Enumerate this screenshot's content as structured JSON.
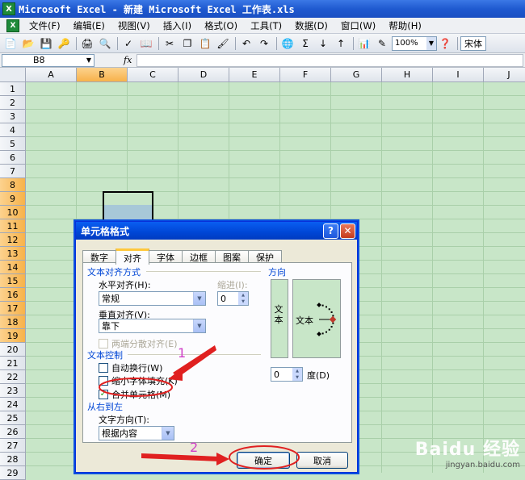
{
  "window": {
    "title": "Microsoft Excel - 新建 Microsoft Excel 工作表.xls",
    "app_icon": "excel-icon"
  },
  "menubar": [
    "文件(F)",
    "编辑(E)",
    "视图(V)",
    "插入(I)",
    "格式(O)",
    "工具(T)",
    "数据(D)",
    "窗口(W)",
    "帮助(H)"
  ],
  "toolbar": {
    "zoom": "100%",
    "font": "宋体"
  },
  "formula_bar": {
    "cell_ref": "B8",
    "fx": "fx",
    "value": ""
  },
  "columns": [
    "A",
    "B",
    "C",
    "D",
    "E",
    "F",
    "G",
    "H",
    "I",
    "J"
  ],
  "selected_column": "B",
  "rows": [
    "1",
    "2",
    "3",
    "4",
    "5",
    "6",
    "7",
    "8",
    "9",
    "10",
    "11",
    "12",
    "13",
    "14",
    "15",
    "16",
    "17",
    "18",
    "19",
    "20",
    "21",
    "22",
    "23",
    "24",
    "25",
    "26",
    "27",
    "28",
    "29"
  ],
  "selected_rows": [
    "8",
    "9",
    "10",
    "11",
    "12",
    "13",
    "14",
    "15",
    "16",
    "17",
    "18",
    "19"
  ],
  "dialog": {
    "title": "单元格格式",
    "help_button": "?",
    "close_button": "✕",
    "tabs": [
      "数字",
      "对齐",
      "字体",
      "边框",
      "图案",
      "保护"
    ],
    "active_tab": "对齐",
    "text_align_section": "文本对齐方式",
    "horizontal_label": "水平对齐(H):",
    "horizontal_value": "常规",
    "indent_label": "缩进(I):",
    "indent_value": "0",
    "vertical_label": "垂直对齐(V):",
    "vertical_value": "靠下",
    "distributed_label": "两端分散对齐(E)",
    "text_control_section": "文本控制",
    "wrap_text": {
      "label": "自动换行(W)",
      "checked": false
    },
    "shrink_to_fit": {
      "label": "缩小字体填充(K)",
      "checked": false
    },
    "merge_cells": {
      "label": "合并单元格(M)",
      "checked": true
    },
    "rtl_section": "从右到左",
    "text_direction_label": "文字方向(T):",
    "text_direction_value": "根据内容",
    "orientation_section": "方向",
    "orientation_vertical_text": "文本",
    "orientation_dial_text": "文本",
    "degree_value": "0",
    "degree_label": "度(D)",
    "ok_button": "确定",
    "cancel_button": "取消"
  },
  "annotations": {
    "step1": "1",
    "step2": "2",
    "color": "#d040c8"
  },
  "watermark": {
    "brand": "Baidu 经验",
    "url": "jingyan.baidu.com"
  }
}
